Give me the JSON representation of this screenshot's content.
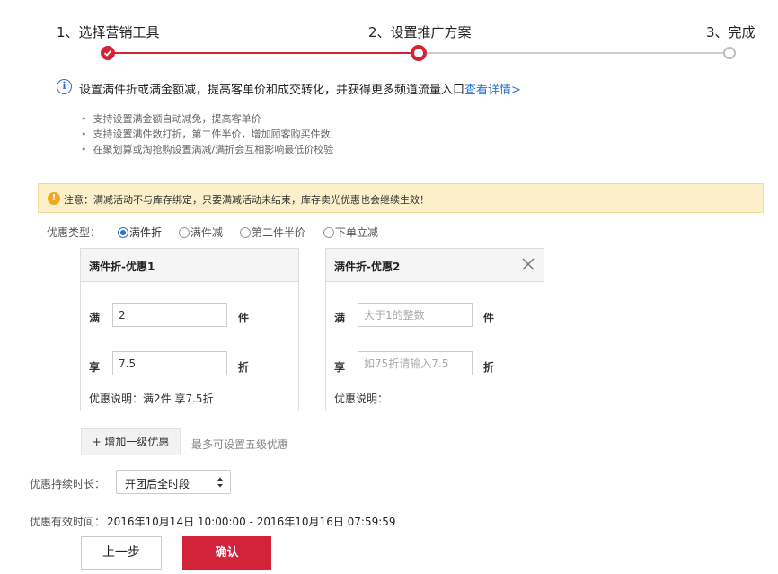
{
  "steps": [
    {
      "label": "1、选择营销工具",
      "state": "done"
    },
    {
      "label": "2、设置推广方案",
      "state": "current"
    },
    {
      "label": "3、完成",
      "state": "pending"
    }
  ],
  "colors": {
    "accent": "#d3233b",
    "link": "#2d6fd2",
    "notice_bg": "#fbf0c9",
    "notice_icon": "#f5a623"
  },
  "info": {
    "icon": "info-icon",
    "text": "设置满件折或满金额减，提高客单价和成交转化，并获得更多频道流量入口",
    "link": "查看详情>",
    "bullets": [
      "支持设置满金额自动减免，提高客单价",
      "支持设置满件数打折，第二件半价，增加顾客购买件数",
      "在聚划算或淘抢购设置满减/满折会互相影响最低价校验"
    ]
  },
  "notice": {
    "icon": "warning-icon",
    "text": "注意：满减活动不与库存绑定，只要满减活动未结束，库存卖光优惠也会继续生效！"
  },
  "discount_type": {
    "label": "优惠类型：",
    "options": [
      "满件折",
      "满件减",
      "第二件半价",
      "下单立减"
    ],
    "selected": "满件折"
  },
  "tiers": [
    {
      "title": "满件折-优惠1",
      "man_label": "满",
      "man_value": "2",
      "man_placeholder": "",
      "man_unit": "件",
      "xiang_label": "享",
      "xiang_value": "7.5",
      "xiang_placeholder": "",
      "xiang_unit": "折",
      "desc": "优惠说明：满2件 享7.5折",
      "closable": false
    },
    {
      "title": "满件折-优惠2",
      "man_label": "满",
      "man_value": "",
      "man_placeholder": "大于1的整数",
      "man_unit": "件",
      "xiang_label": "享",
      "xiang_value": "",
      "xiang_placeholder": "如75折请输入7.5",
      "xiang_unit": "折",
      "desc": "优惠说明：",
      "closable": true
    }
  ],
  "add_level": {
    "button": "+ 增加一级优惠",
    "tip": "最多可设置五级优惠"
  },
  "duration": {
    "label": "优惠持续时长：",
    "selected": "开团后全时段",
    "arrow_icon": "select-arrows-icon"
  },
  "validity": {
    "label": "优惠有效时间：",
    "value": "2016年10月14日 10:00:00 - 2016年10月16日 07:59:59"
  },
  "actions": {
    "prev": "上一步",
    "confirm": "确认"
  }
}
